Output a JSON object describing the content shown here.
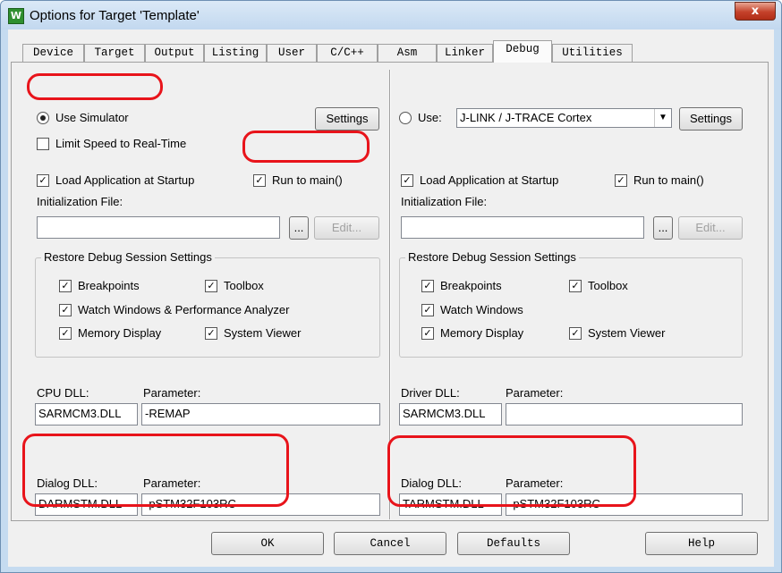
{
  "window": {
    "title": "Options for Target 'Template'",
    "close_glyph": "x",
    "icon_glyph": "W"
  },
  "tabs": [
    "Device",
    "Target",
    "Output",
    "Listing",
    "User",
    "C/C++",
    "Asm",
    "Linker",
    "Debug",
    "Utilities"
  ],
  "active_tab": "Debug",
  "left": {
    "use_simulator": "Use Simulator",
    "settings": "Settings",
    "limit_speed": "Limit Speed to Real-Time",
    "load_app": "Load Application at Startup",
    "run_to_main": "Run to main()",
    "init_file_label": "Initialization File:",
    "init_file_value": "",
    "browse": "...",
    "edit": "Edit...",
    "restore_group": "Restore Debug Session Settings",
    "breakpoints": "Breakpoints",
    "toolbox": "Toolbox",
    "watch": "Watch Windows & Performance Analyzer",
    "memory": "Memory Display",
    "system_viewer": "System Viewer",
    "cpu_dll_label": "CPU DLL:",
    "cpu_param_label": "Parameter:",
    "cpu_dll": "SARMCM3.DLL",
    "cpu_param": "-REMAP",
    "dialog_dll_label": "Dialog DLL:",
    "dialog_param_label": "Parameter:",
    "dialog_dll": "DARMSTM.DLL",
    "dialog_param": "-pSTM32F103RC"
  },
  "right": {
    "use": "Use:",
    "driver": "J-LINK / J-TRACE Cortex",
    "settings": "Settings",
    "load_app": "Load Application at Startup",
    "run_to_main": "Run to main()",
    "init_file_label": "Initialization File:",
    "init_file_value": "",
    "browse": "...",
    "edit": "Edit...",
    "restore_group": "Restore Debug Session Settings",
    "breakpoints": "Breakpoints",
    "toolbox": "Toolbox",
    "watch": "Watch Windows",
    "memory": "Memory Display",
    "system_viewer": "System Viewer",
    "driver_dll_label": "Driver DLL:",
    "driver_param_label": "Parameter:",
    "driver_dll": "SARMCM3.DLL",
    "driver_param": "",
    "dialog_dll_label": "Dialog DLL:",
    "dialog_param_label": "Parameter:",
    "dialog_dll": "TARMSTM.DLL",
    "dialog_param": "-pSTM32F103RC"
  },
  "buttons": {
    "ok": "OK",
    "cancel": "Cancel",
    "defaults": "Defaults",
    "help": "Help"
  },
  "check_glyph": "✓",
  "colors": {
    "highlight": "#e8141b",
    "title_bar": "#c5dbf0",
    "close_button": "#c4412a"
  }
}
